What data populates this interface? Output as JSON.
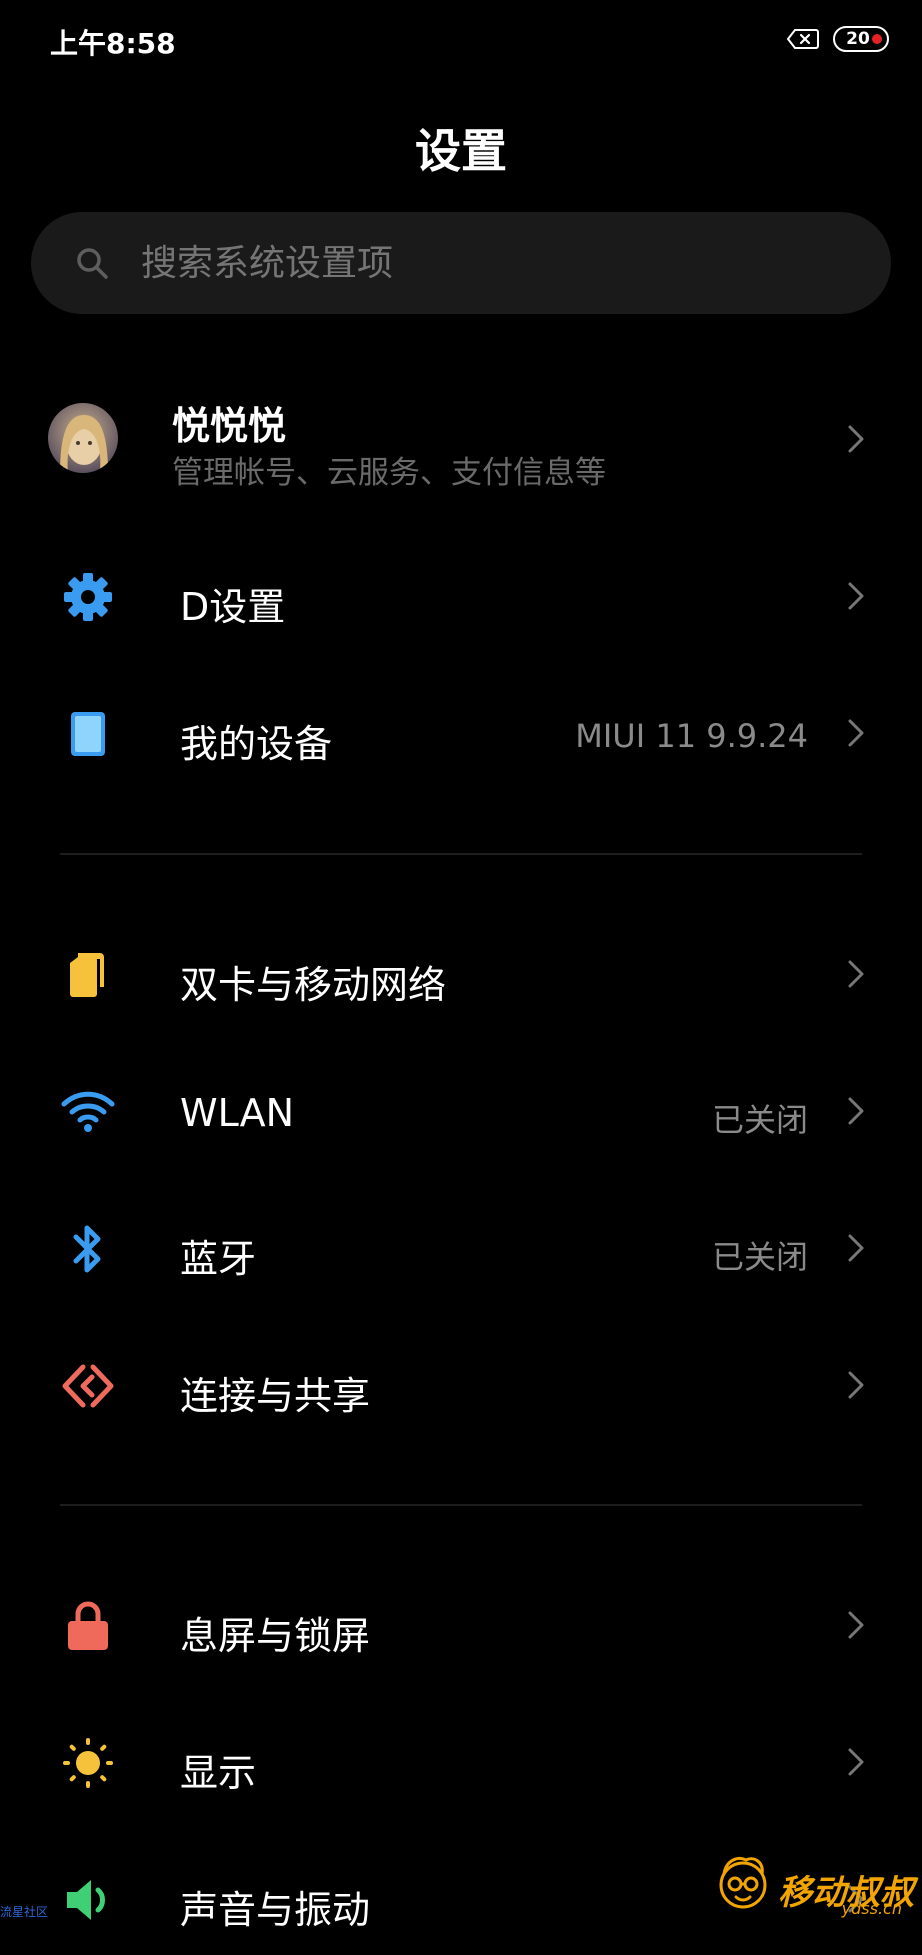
{
  "status_bar": {
    "time": "上午8:58",
    "battery": "20"
  },
  "header": {
    "title": "设置"
  },
  "search": {
    "placeholder": "搜索系统设置项"
  },
  "account": {
    "name": "悦悦悦",
    "subtitle": "管理帐号、云服务、支付信息等"
  },
  "items": [
    {
      "label": "D设置",
      "value": "",
      "icon": "gear-icon",
      "color": "#3a9cf0"
    },
    {
      "label": "我的设备",
      "value": "MIUI 11 9.9.24",
      "icon": "phone-device-icon",
      "color": "#6fc3f5"
    },
    {
      "label": "双卡与移动网络",
      "value": "",
      "icon": "sim-card-icon",
      "color": "#f7c23b"
    },
    {
      "label": "WLAN",
      "value": "已关闭",
      "icon": "wifi-icon",
      "color": "#3a9cf0"
    },
    {
      "label": "蓝牙",
      "value": "已关闭",
      "icon": "bluetooth-icon",
      "color": "#3a9cf0"
    },
    {
      "label": "连接与共享",
      "value": "",
      "icon": "connection-share-icon",
      "color": "#f06a5c"
    },
    {
      "label": "息屏与锁屏",
      "value": "",
      "icon": "lock-icon",
      "color": "#f06a5c"
    },
    {
      "label": "显示",
      "value": "",
      "icon": "sun-icon",
      "color": "#f7c23b"
    },
    {
      "label": "声音与振动",
      "value": "",
      "icon": "speaker-icon",
      "color": "#3fcf75"
    }
  ],
  "watermark": {
    "left_text": "流星社区",
    "right_text": "移动叔叔",
    "right_sub": "ydss.cn"
  }
}
